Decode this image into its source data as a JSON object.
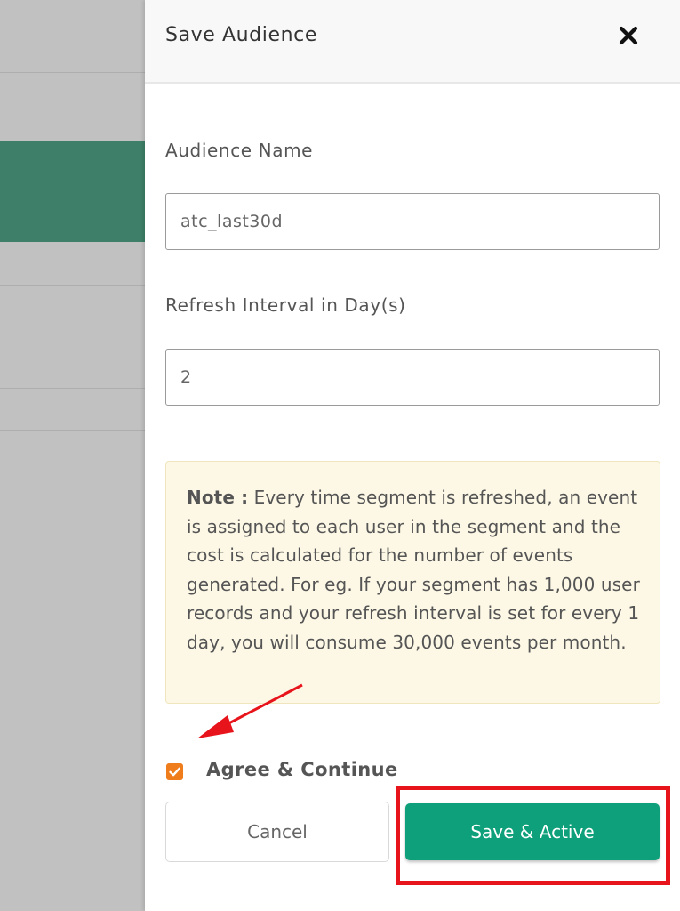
{
  "drawer": {
    "title": "Save Audience",
    "close_icon": "close-x-icon"
  },
  "form": {
    "audience_name_label": "Audience Name",
    "audience_name_value": "atc_last30d",
    "refresh_label": "Refresh Interval in Day(s)",
    "refresh_value": "2"
  },
  "note": {
    "prefix": "Note :",
    "text": " Every time segment is refreshed, an event is assigned to each user in the segment and the cost is calculated for the number of events generated. For eg. If your segment has 1,000 user records and your refresh interval is set for every 1 day, you will consume 30,000 events per month."
  },
  "agree": {
    "label": "Agree & Continue",
    "checked": true
  },
  "buttons": {
    "cancel": "Cancel",
    "save": "Save & Active"
  },
  "colors": {
    "accent_green": "#0ea07a",
    "checkbox_orange": "#ef7d1c",
    "annotation_red": "#e8141c",
    "note_background": "#fdf8e6"
  }
}
